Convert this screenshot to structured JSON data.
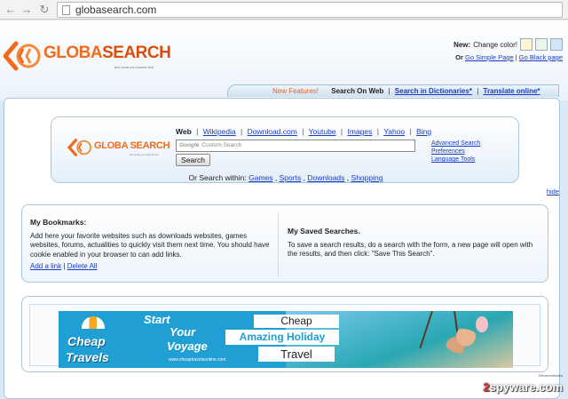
{
  "browser": {
    "url": "globasearch.com",
    "back_icon": "back-arrow-icon",
    "forward_icon": "forward-arrow-icon",
    "reload_icon": "reload-icon"
  },
  "header": {
    "logo_text_part1": "GLOBA",
    "logo_text_part2": "SEARCH",
    "logo_tagline": "find what you wanna find",
    "new_label": "New:",
    "change_color": "Change color!",
    "swatches": [
      "#fdf6d8",
      "#eaf4ea",
      "#cfe6f7"
    ],
    "or_label": "Or",
    "simple_page": "Go Simple Page",
    "pipe": "|",
    "black_page": "Go Black page"
  },
  "tabs": {
    "new_features": "New Features!",
    "search_on_web": "Search On Web",
    "search_dictionaries": "Search in Dictionaries*",
    "translate_online": "Translate online*",
    "sep": "|"
  },
  "search": {
    "logo_text": "GLOBA SEARCH",
    "logo_tagline": "find what you wanna find",
    "engines": [
      "Web",
      "Wikipedia",
      "Download.com",
      "Youtube",
      "Images",
      "Yahoo",
      "Bing"
    ],
    "input_brand": "Google",
    "input_placeholder": "Custom Search",
    "button_label": "Search",
    "advanced": "Advanced Search",
    "preferences": "Preferences",
    "language_tools": "Language Tools",
    "or_within": "Or Search within:",
    "within_links": [
      "Games",
      "Sports",
      "Downloads",
      "Shopping"
    ],
    "comma": ","
  },
  "hide_label": "hide",
  "bookmarks": {
    "title": "My Bookmarks:",
    "text": "Add here your favorite websites such as downloads websites, games websites, forums, actualities to quickly visit them next time. You should have cookie enabled in your browser to can add links.",
    "add_link": "Add a link",
    "delete_all": "Delete All",
    "sep": "|"
  },
  "saved_searches": {
    "title": "My Saved Searches.",
    "text": "To save a search results, do a search with the form, a new page will open with the results, and then click: \"Save This Search\"."
  },
  "ad": {
    "brand_line1": "Cheap",
    "brand_line2": "Travels",
    "start": "Start",
    "your": "Your",
    "voyage": "Voyage",
    "url": "www.cheaptravelsonline.com",
    "cheap": "Cheap",
    "amazing": "Amazing Holiday",
    "travel": "Travel"
  },
  "watermark": {
    "number": "2",
    "text": "spyware.com",
    "badge": "Recommended"
  }
}
